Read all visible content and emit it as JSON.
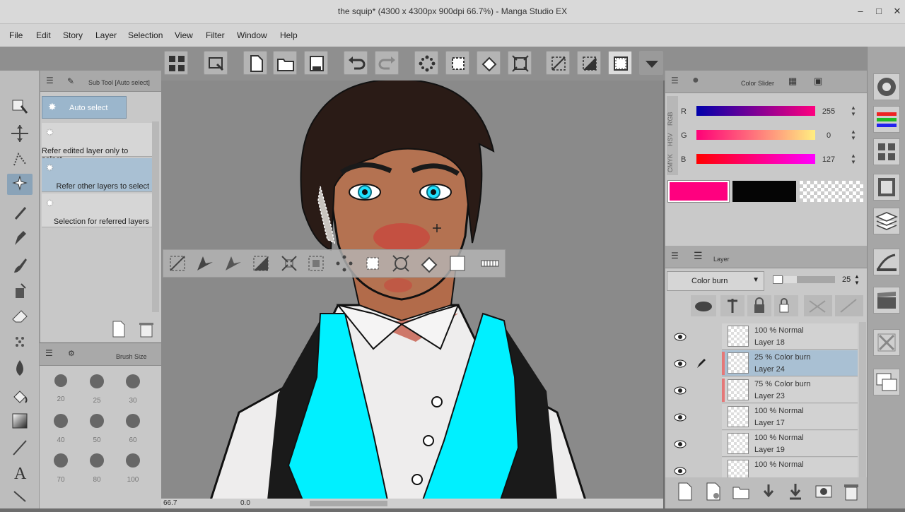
{
  "window": {
    "title": "the squip* (4300 x 4300px 900dpi 66.7%)  - Manga Studio EX",
    "minimize": "‒",
    "maximize": "□",
    "close": "✕"
  },
  "menu": [
    "File",
    "Edit",
    "Story",
    "Layer",
    "Selection",
    "View",
    "Filter",
    "Window",
    "Help"
  ],
  "subtool": {
    "header": "Sub Tool [Auto select]",
    "tab_active": "Auto select",
    "items": [
      {
        "label": "Refer edited layer only to select",
        "selected": false
      },
      {
        "label": "Refer other layers to select",
        "selected": true
      },
      {
        "label": "Selection for referred layers",
        "selected": false
      }
    ]
  },
  "brush_size": {
    "header": "Brush Size",
    "sizes": [
      "20",
      "25",
      "30",
      "40",
      "50",
      "60",
      "70",
      "80",
      "100"
    ]
  },
  "color_slider": {
    "header": "Color Slider",
    "tabs": [
      "RGB",
      "HSV",
      "CMYK"
    ],
    "channels": [
      {
        "name": "R",
        "value": "255"
      },
      {
        "name": "G",
        "value": "0"
      },
      {
        "name": "B",
        "value": "127"
      }
    ],
    "main_color": "#ff007f",
    "sub_color": "#050505"
  },
  "layer": {
    "header": "Layer",
    "blend_mode": "Color burn",
    "opacity": "25",
    "rows": [
      {
        "mode": "100 %   Normal",
        "name": "Layer 18",
        "selected": false,
        "marked": false
      },
      {
        "mode": "25 %   Color burn",
        "name": "Layer 24",
        "selected": true,
        "marked": true
      },
      {
        "mode": "75 %   Color burn",
        "name": "Layer 23",
        "selected": false,
        "marked": true
      },
      {
        "mode": "100 %   Normal",
        "name": "Layer 17",
        "selected": false,
        "marked": false
      },
      {
        "mode": "100 %   Normal",
        "name": "Layer 19",
        "selected": false,
        "marked": false
      },
      {
        "mode": "100 %   Normal",
        "name": "",
        "selected": false,
        "marked": false
      }
    ]
  },
  "status": {
    "zoom": "66.7",
    "angle": "0.0"
  }
}
